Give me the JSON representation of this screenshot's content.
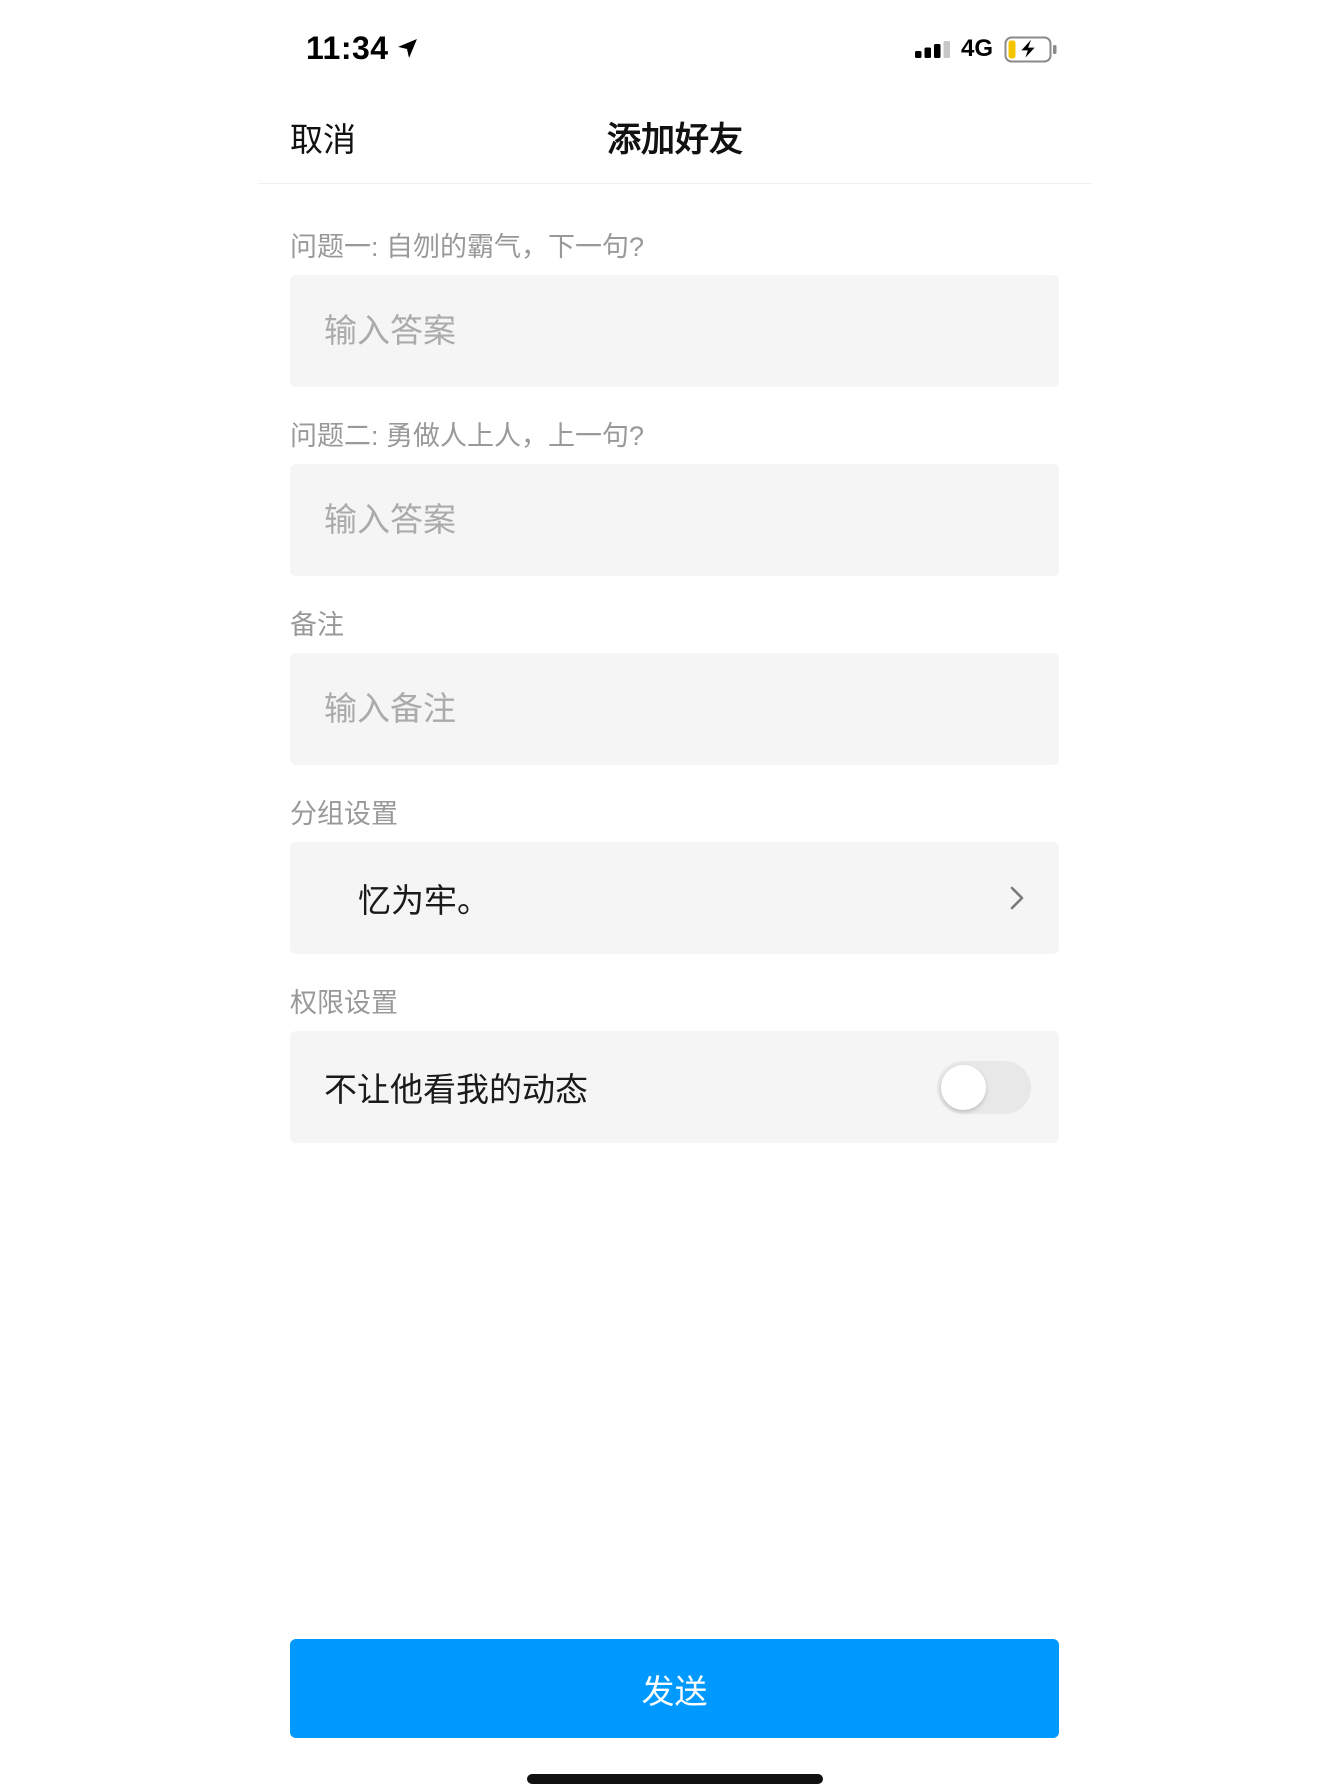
{
  "status_bar": {
    "time": "11:34",
    "network": "4G",
    "location_icon": "location-arrow-icon",
    "signal_icon": "signal-bars-icon",
    "battery_icon": "battery-charging-icon"
  },
  "nav": {
    "cancel_label": "取消",
    "title": "添加好友"
  },
  "form": {
    "question1": {
      "label": "问题一: 自刎的霸气，下一句?",
      "placeholder": "输入答案"
    },
    "question2": {
      "label": "问题二: 勇做人上人，上一句?",
      "placeholder": "输入答案"
    },
    "remark": {
      "label": "备注",
      "placeholder": "输入备注"
    },
    "group": {
      "label": "分组设置",
      "value": "忆为牢。",
      "icon": "chevron-right-icon"
    },
    "permission": {
      "label": "权限设置",
      "option_label": "不让他看我的动态",
      "enabled": false
    }
  },
  "send_label": "发送",
  "colors": {
    "accent": "#0099ff",
    "card_background": "#f5f5f5",
    "label_text": "#999999",
    "placeholder_text": "#ababab"
  }
}
